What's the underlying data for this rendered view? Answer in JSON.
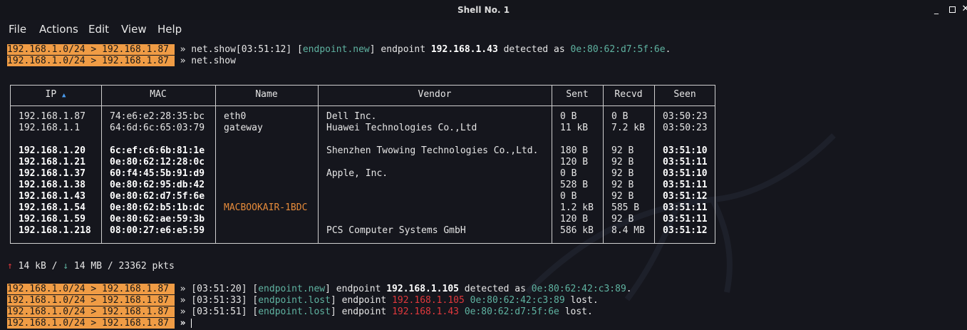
{
  "window": {
    "title": "Shell No. 1",
    "controls": [
      "minimize-icon",
      "maximize-icon",
      "close-icon"
    ]
  },
  "menu": [
    "File",
    "Actions",
    "Edit",
    "View",
    "Help"
  ],
  "prompt": "192.168.1.0/24 > 192.168.1.87 ",
  "arrow": "»",
  "lines_top": [
    {
      "cmd": "net.show[03:51:12] [",
      "tag": "endpoint.new",
      "rest": "] endpoint ",
      "ip": "192.168.1.43",
      "rest2": " detected as ",
      "mac": "0e:80:62:d7:5f:6e",
      "end": "."
    },
    {
      "cmd": "net.show"
    }
  ],
  "table": {
    "headers": [
      "IP",
      "MAC",
      "Name",
      "Vendor",
      "Sent",
      "Recvd",
      "Seen"
    ],
    "sort_icon": "▲",
    "rows": [
      {
        "ip": "192.168.1.87",
        "mac": "74:e6:e2:28:35:bc",
        "name": "eth0",
        "vendor": "Dell Inc.",
        "sent": "0 B",
        "recvd": "0 B",
        "seen": "03:50:23",
        "bold": false
      },
      {
        "ip": "192.168.1.1",
        "mac": "64:6d:6c:65:03:79",
        "name": "gateway",
        "vendor": "Huawei Technologies Co.,Ltd",
        "sent": "11 kB",
        "recvd": "7.2 kB",
        "seen": "03:50:23",
        "bold": false
      },
      {
        "ip": "192.168.1.20",
        "mac": "6c:ef:c6:6b:81:1e",
        "name": "",
        "vendor": "Shenzhen Twowing Technologies Co.,Ltd.",
        "sent": "180 B",
        "recvd": "92 B",
        "seen": "03:51:10",
        "bold": true
      },
      {
        "ip": "192.168.1.21",
        "mac": "0e:80:62:12:28:0c",
        "name": "",
        "vendor": "",
        "sent": "120 B",
        "recvd": "92 B",
        "seen": "03:51:11",
        "bold": true
      },
      {
        "ip": "192.168.1.37",
        "mac": "60:f4:45:5b:91:d9",
        "name": "",
        "vendor": "Apple, Inc.",
        "sent": "0 B",
        "recvd": "92 B",
        "seen": "03:51:10",
        "bold": true
      },
      {
        "ip": "192.168.1.38",
        "mac": "0e:80:62:95:db:42",
        "name": "",
        "vendor": "",
        "sent": "528 B",
        "recvd": "92 B",
        "seen": "03:51:11",
        "bold": true
      },
      {
        "ip": "192.168.1.43",
        "mac": "0e:80:62:d7:5f:6e",
        "name": "",
        "vendor": "",
        "sent": "0 B",
        "recvd": "92 B",
        "seen": "03:51:12",
        "bold": true
      },
      {
        "ip": "192.168.1.54",
        "mac": "0e:80:62:b5:1b:dc",
        "name": "MACBOOKAIR-1BDC",
        "vendor": "",
        "sent": "1.2 kB",
        "recvd": "585 B",
        "seen": "03:51:11",
        "bold": true
      },
      {
        "ip": "192.168.1.59",
        "mac": "0e:80:62:ae:59:3b",
        "name": "",
        "vendor": "",
        "sent": "120 B",
        "recvd": "92 B",
        "seen": "03:51:11",
        "bold": true
      },
      {
        "ip": "192.168.1.218",
        "mac": "08:00:27:e6:e5:59",
        "name": "",
        "vendor": "PCS Computer Systems GmbH",
        "sent": "586 kB",
        "recvd": "8.4 MB",
        "seen": "03:51:12",
        "bold": true
      }
    ]
  },
  "stats": {
    "up_icon": "↑",
    "up": " 14 kB / ",
    "down_icon": "↓",
    "down": " 14 MB / 23362 pkts"
  },
  "lines_bottom": [
    {
      "pre": "[03:51:20] [",
      "tag": "endpoint.new",
      "mid": "] endpoint ",
      "ip": "192.168.1.105",
      "mid2": " detected as ",
      "mac": "0e:80:62:42:c3:89",
      "end": ".",
      "type": "new"
    },
    {
      "pre": "[03:51:33] [",
      "tag": "endpoint.lost",
      "mid": "] endpoint ",
      "ip": "192.168.1.105",
      "mid2": " ",
      "mac": "0e:80:62:42:c3:89",
      "end": " lost.",
      "type": "lost"
    },
    {
      "pre": "[03:51:51] [",
      "tag": "endpoint.lost",
      "mid": "] endpoint ",
      "ip": "192.168.1.43",
      "mid2": " ",
      "mac": "0e:80:62:d7:5f:6e",
      "end": " lost.",
      "type": "lost"
    }
  ],
  "colors": {
    "prompt_bg": "#f09c45",
    "tag": "#5fb3a1",
    "lost_ip": "#e0383c",
    "name_highlight": "#e58a3a",
    "background": "#15161d"
  }
}
